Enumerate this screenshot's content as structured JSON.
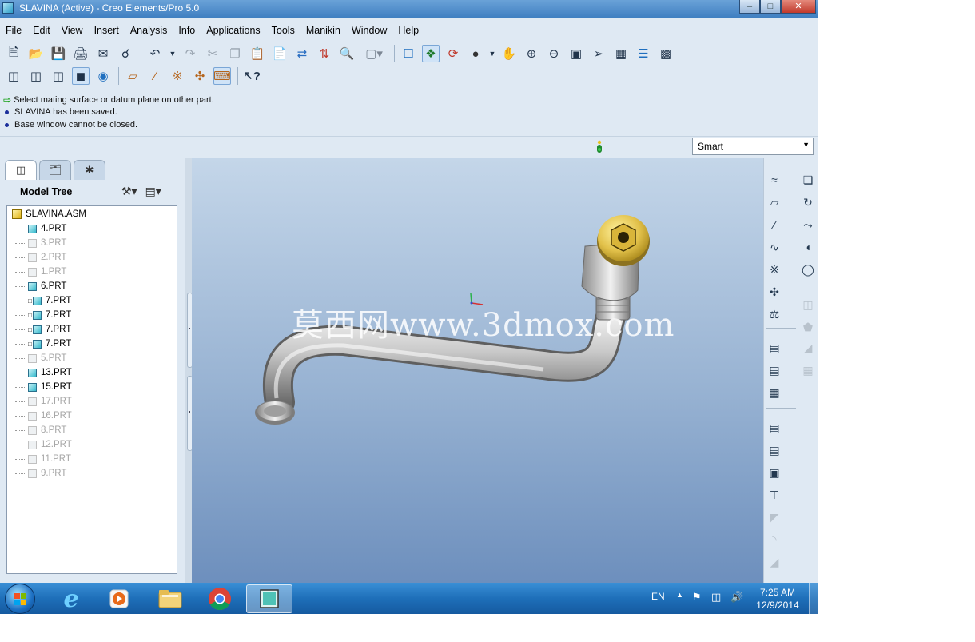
{
  "window": {
    "title": "SLAVINA (Active) - Creo Elements/Pro 5.0",
    "controls": [
      "minimize",
      "maximize",
      "close"
    ]
  },
  "menubar": [
    "File",
    "Edit",
    "View",
    "Insert",
    "Analysis",
    "Info",
    "Applications",
    "Tools",
    "Manikin",
    "Window",
    "Help"
  ],
  "messages": [
    {
      "kind": "prompt",
      "text": "Select mating surface or datum plane on other part."
    },
    {
      "kind": "info",
      "text": "SLAVINA has been saved."
    },
    {
      "kind": "info",
      "text": "Base window cannot be closed."
    }
  ],
  "filter": {
    "selected": "Smart"
  },
  "model_tree": {
    "title": "Model Tree",
    "root": "SLAVINA.ASM",
    "items": [
      {
        "label": "4.PRT",
        "dim": false,
        "pre": ""
      },
      {
        "label": "3.PRT",
        "dim": true,
        "pre": ""
      },
      {
        "label": "2.PRT",
        "dim": true,
        "pre": ""
      },
      {
        "label": "1.PRT",
        "dim": true,
        "pre": ""
      },
      {
        "label": "6.PRT",
        "dim": false,
        "pre": ""
      },
      {
        "label": "7.PRT",
        "dim": false,
        "pre": "□"
      },
      {
        "label": "7.PRT",
        "dim": false,
        "pre": "□"
      },
      {
        "label": "7.PRT",
        "dim": false,
        "pre": "□"
      },
      {
        "label": "7.PRT",
        "dim": false,
        "pre": "□"
      },
      {
        "label": "5.PRT",
        "dim": true,
        "pre": ""
      },
      {
        "label": "13.PRT",
        "dim": false,
        "pre": ""
      },
      {
        "label": "15.PRT",
        "dim": false,
        "pre": ""
      },
      {
        "label": "17.PRT",
        "dim": true,
        "pre": ""
      },
      {
        "label": "16.PRT",
        "dim": true,
        "pre": ""
      },
      {
        "label": "8.PRT",
        "dim": true,
        "pre": ""
      },
      {
        "label": "12.PRT",
        "dim": true,
        "pre": ""
      },
      {
        "label": "11.PRT",
        "dim": true,
        "pre": ""
      },
      {
        "label": "9.PRT",
        "dim": true,
        "pre": ""
      }
    ]
  },
  "viewport": {
    "watermark": "莫西网www.3dmox.com"
  },
  "taskbar": {
    "language": "EN",
    "time": "7:25 AM",
    "date": "12/9/2014"
  },
  "colors": {
    "accent_blue": "#3f7fc1",
    "brass": "#e2c14a"
  }
}
